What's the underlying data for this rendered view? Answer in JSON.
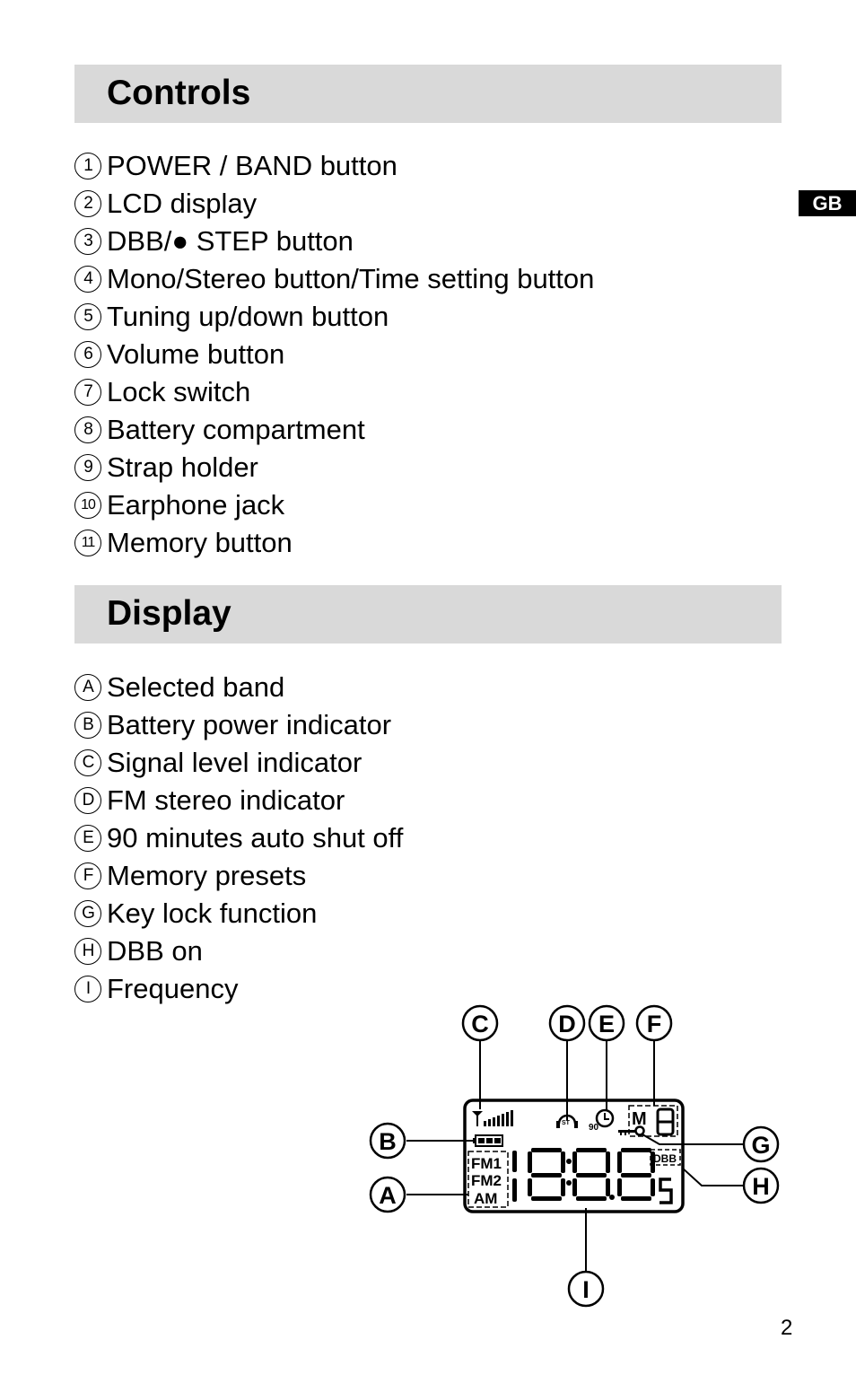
{
  "language_tab": "GB",
  "page_number": "2",
  "controls": {
    "title": "Controls",
    "items": [
      {
        "marker": "1",
        "label": "POWER / BAND button"
      },
      {
        "marker": "2",
        "label": "LCD display"
      },
      {
        "marker": "3",
        "label": "DBB/● STEP button"
      },
      {
        "marker": "4",
        "label": "Mono/Stereo button/Time setting button"
      },
      {
        "marker": "5",
        "label": "Tuning up/down button"
      },
      {
        "marker": "6",
        "label": "Volume button"
      },
      {
        "marker": "7",
        "label": "Lock switch"
      },
      {
        "marker": "8",
        "label": "Battery compartment"
      },
      {
        "marker": "9",
        "label": "Strap holder"
      },
      {
        "marker": "10",
        "label": "Earphone jack"
      },
      {
        "marker": "11",
        "label": "Memory button"
      }
    ]
  },
  "display": {
    "title": "Display",
    "items": [
      {
        "marker": "A",
        "label": "Selected band"
      },
      {
        "marker": "B",
        "label": "Battery power indicator"
      },
      {
        "marker": "C",
        "label": "Signal level indicator"
      },
      {
        "marker": "D",
        "label": "FM stereo indicator"
      },
      {
        "marker": "E",
        "label": "90 minutes auto shut off"
      },
      {
        "marker": "F",
        "label": "Memory presets"
      },
      {
        "marker": "G",
        "label": "Key lock function"
      },
      {
        "marker": "H",
        "label": "DBB on"
      },
      {
        "marker": "I",
        "label": "Frequency"
      }
    ]
  },
  "lcd_diagram": {
    "callouts": [
      "A",
      "B",
      "C",
      "D",
      "E",
      "F",
      "G",
      "H",
      "I"
    ],
    "band_labels": [
      "FM1",
      "FM2",
      "AM"
    ],
    "stereo_label": "ST",
    "timer_label": "90",
    "memory_label": "M",
    "dbb_label": "DBB",
    "frequency_digits": "1888",
    "unit_digit": "5"
  }
}
